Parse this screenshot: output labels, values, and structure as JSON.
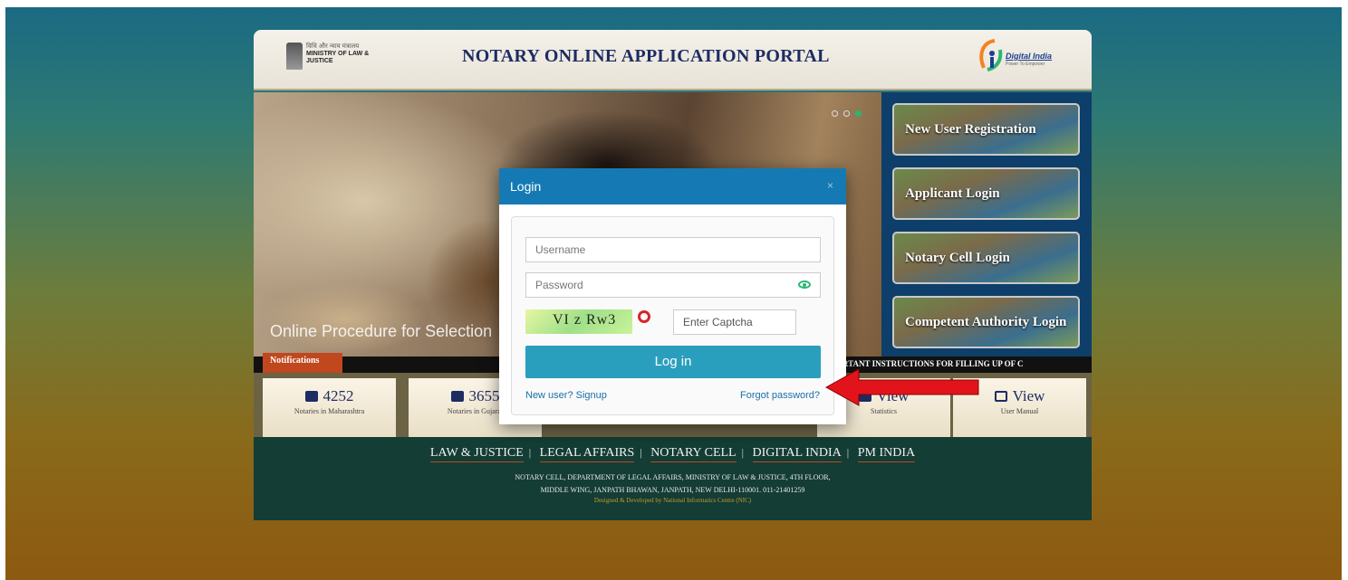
{
  "header": {
    "ministry_hindi": "विधि और न्याय मंत्रालय",
    "ministry_line": "MINISTRY OF LAW & JUSTICE",
    "title": "NOTARY ONLINE APPLICATION PORTAL",
    "digital_india": "Digital India",
    "digital_india_tag": "Power To Empower"
  },
  "hero": {
    "caption": "Online Procedure for Selection",
    "slide_dots": 3,
    "active_slide": 3
  },
  "side_buttons": [
    {
      "label": "New User Registration"
    },
    {
      "label": "Applicant Login"
    },
    {
      "label": "Notary Cell Login"
    },
    {
      "label": "Competent Authority Login"
    }
  ],
  "ticker": {
    "tag": "Notifications",
    "text": "RTANT INSTRUCTIONS FOR FILLING UP OF C"
  },
  "stats": [
    {
      "value": "4252",
      "label": "Notaries in Maharashtra",
      "icon": "list-icon"
    },
    {
      "value": "3655",
      "label": "Notaries in Gujarat",
      "icon": "list-icon"
    },
    {
      "value": "View",
      "label": "Statistics",
      "icon": "list-icon"
    },
    {
      "value": "View",
      "label": "User Manual",
      "icon": "book-icon"
    }
  ],
  "footer": {
    "links": [
      "LAW & JUSTICE",
      "LEGAL AFFAIRS",
      "NOTARY CELL",
      "DIGITAL INDIA",
      "PM INDIA"
    ],
    "address_1": "NOTARY CELL, DEPARTMENT OF LEGAL AFFAIRS, MINISTRY OF LAW & JUSTICE, 4TH FLOOR,",
    "address_2": "MIDDLE WING, JANPATH BHAWAN, JANPATH, NEW DELHI-110001. 011-21401259",
    "credit": "Designed & Developed by National Informatics Centre (NIC)"
  },
  "modal": {
    "title": "Login",
    "close": "×",
    "username_placeholder": "Username",
    "password_placeholder": "Password",
    "captcha_text": "VI z Rw3",
    "captcha_placeholder": "Enter Captcha",
    "login_label": "Log in",
    "signup_label": "New user? Signup",
    "forgot_label": "Forgot password?"
  },
  "colors": {
    "modal_header": "#157ab4",
    "login_button": "#2a9fbd",
    "title": "#1d2c62",
    "arrow": "#e3131b"
  }
}
